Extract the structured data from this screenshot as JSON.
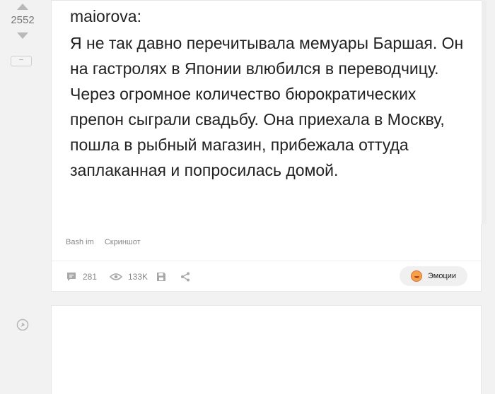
{
  "vote": {
    "rating": "2552",
    "collapse_label": "−"
  },
  "post": {
    "author": "maiorova:",
    "text": "Я не так давно перечитывала мемуары Баршая. Он на гастролях в Японии влюбился в переводчицу. Через огромное количество бюрократических препон сыграли свадьбу. Она приехала в Москву, пошла в рыбный магазин, прибежала оттуда заплаканная и попросилась домой.",
    "tags": [
      "Bash im",
      "Скриншот"
    ]
  },
  "footer": {
    "comments_count": "281",
    "views_count": "133K",
    "emotions_label": "Эмоции"
  },
  "icons": {
    "comments": "speech-bubble-icon",
    "views": "eye-icon",
    "save": "floppy-disk-icon",
    "share": "share-icon",
    "emotion": "smiling-face-icon",
    "pin": "pin-icon"
  },
  "colors": {
    "background": "#f2f2f2",
    "card": "#ffffff",
    "muted_text": "#888888",
    "body_text": "#222222"
  }
}
